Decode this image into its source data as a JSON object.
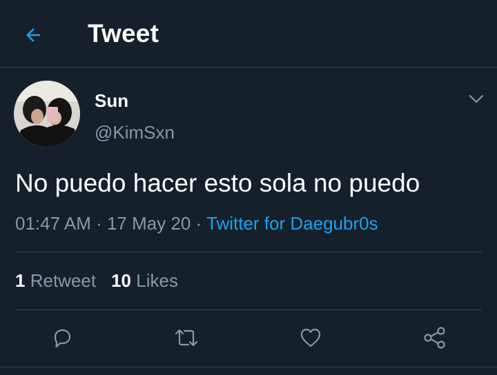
{
  "header": {
    "title": "Tweet"
  },
  "tweet": {
    "display_name": "Sun",
    "handle": "@KimSxn",
    "text": "No puedo hacer esto sola no puedo",
    "time": "01:47 AM",
    "separator": " · ",
    "date": "17 May 20",
    "source": "Twitter for Daegubr0s"
  },
  "stats": {
    "retweets_count": "1",
    "retweets_label": "Retweet",
    "likes_count": "10",
    "likes_label": "Likes"
  },
  "actions": [
    {
      "icon": "reply-icon"
    },
    {
      "icon": "retweet-icon"
    },
    {
      "icon": "like-icon"
    },
    {
      "icon": "share-icon"
    }
  ],
  "colors": {
    "background": "#15202b",
    "accent": "#1da1f2",
    "secondary_text": "#8899a6",
    "divider": "#38444d"
  }
}
